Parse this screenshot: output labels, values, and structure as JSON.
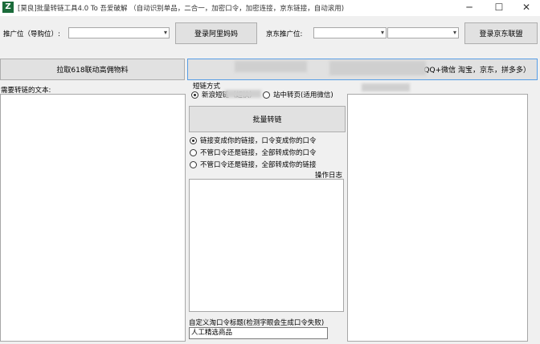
{
  "window": {
    "title": "[莫良]批量转链工具4.0 To 吾爱破解 （自动识别单品，二合一，加密口令，加密连接，京东链接，自动滚用)",
    "minimize_glyph": "─",
    "maximize_glyph": "☐",
    "close_glyph": "✕"
  },
  "toolbar": {
    "promo_label": "推广位（导购位）:",
    "promo_value": "",
    "login_ali_label": "登录阿里妈妈",
    "jd_promo_label": "京东推广位:",
    "jd_promo_value_1": "",
    "jd_promo_value_2": "",
    "login_jd_label": "登录京东联盟"
  },
  "actions": {
    "pull_material_label": "拉取618联动高佣物料",
    "right_banner_label": "(QQ+微信 淘宝，京东，拼多多）"
  },
  "left": {
    "input_label": "需要转链的文本:"
  },
  "middle": {
    "short_link_label": "短链方式",
    "option_new_short": "新浪短链（超快）",
    "option_mid_short": "站中转页(适用微信)",
    "batch_button_label": "批量转链",
    "mode_options": [
      {
        "label": "链接变成你的链接，口令变成你的口令",
        "checked": true
      },
      {
        "label": "不管口令还是链接，全部转成你的口令",
        "checked": false
      },
      {
        "label": "不管口令还是链接，全部转成你的链接",
        "checked": false
      }
    ],
    "log_label": "操作日志",
    "custom_label": "自定义淘口令标题(检测字眼会生成口令失败)",
    "custom_value": "人工精选商品"
  },
  "colors": {
    "window_bg": "#f0f0f0",
    "button_bg": "#e1e1e1",
    "icon_green": "#1b6b3a"
  }
}
